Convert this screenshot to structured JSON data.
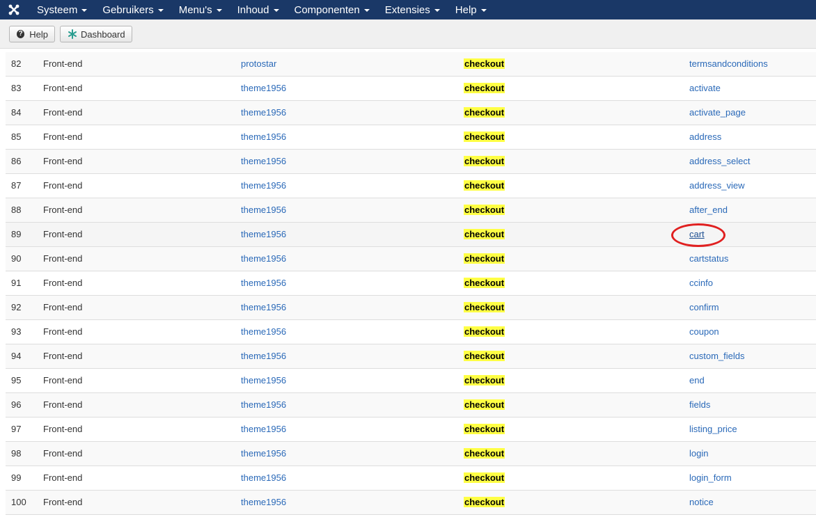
{
  "navbar": {
    "logo_icon": "joomla-logo-icon",
    "menu": [
      {
        "label": "Systeem"
      },
      {
        "label": "Gebruikers"
      },
      {
        "label": "Menu's"
      },
      {
        "label": "Inhoud"
      },
      {
        "label": "Componenten"
      },
      {
        "label": "Extensies"
      },
      {
        "label": "Help"
      }
    ]
  },
  "toolbar": {
    "help_label": "Help",
    "dashboard_label": "Dashboard",
    "help_icon": "question-circle-icon",
    "dashboard_icon": "dashboard-asterisk-icon"
  },
  "colors": {
    "navbar": "#1a3867",
    "link": "#2a69b8",
    "highlight": "#ffff44",
    "annotation": "#e02020"
  },
  "table": {
    "rows": [
      {
        "id": "82",
        "location": "Front-end",
        "template": "protostar",
        "view": "checkout",
        "file": "termsandconditions"
      },
      {
        "id": "83",
        "location": "Front-end",
        "template": "theme1956",
        "view": "checkout",
        "file": "activate"
      },
      {
        "id": "84",
        "location": "Front-end",
        "template": "theme1956",
        "view": "checkout",
        "file": "activate_page"
      },
      {
        "id": "85",
        "location": "Front-end",
        "template": "theme1956",
        "view": "checkout",
        "file": "address"
      },
      {
        "id": "86",
        "location": "Front-end",
        "template": "theme1956",
        "view": "checkout",
        "file": "address_select"
      },
      {
        "id": "87",
        "location": "Front-end",
        "template": "theme1956",
        "view": "checkout",
        "file": "address_view"
      },
      {
        "id": "88",
        "location": "Front-end",
        "template": "theme1956",
        "view": "checkout",
        "file": "after_end"
      },
      {
        "id": "89",
        "location": "Front-end",
        "template": "theme1956",
        "view": "checkout",
        "file": "cart"
      },
      {
        "id": "90",
        "location": "Front-end",
        "template": "theme1956",
        "view": "checkout",
        "file": "cartstatus"
      },
      {
        "id": "91",
        "location": "Front-end",
        "template": "theme1956",
        "view": "checkout",
        "file": "ccinfo"
      },
      {
        "id": "92",
        "location": "Front-end",
        "template": "theme1956",
        "view": "checkout",
        "file": "confirm"
      },
      {
        "id": "93",
        "location": "Front-end",
        "template": "theme1956",
        "view": "checkout",
        "file": "coupon"
      },
      {
        "id": "94",
        "location": "Front-end",
        "template": "theme1956",
        "view": "checkout",
        "file": "custom_fields"
      },
      {
        "id": "95",
        "location": "Front-end",
        "template": "theme1956",
        "view": "checkout",
        "file": "end"
      },
      {
        "id": "96",
        "location": "Front-end",
        "template": "theme1956",
        "view": "checkout",
        "file": "fields"
      },
      {
        "id": "97",
        "location": "Front-end",
        "template": "theme1956",
        "view": "checkout",
        "file": "listing_price"
      },
      {
        "id": "98",
        "location": "Front-end",
        "template": "theme1956",
        "view": "checkout",
        "file": "login"
      },
      {
        "id": "99",
        "location": "Front-end",
        "template": "theme1956",
        "view": "checkout",
        "file": "login_form"
      },
      {
        "id": "100",
        "location": "Front-end",
        "template": "theme1956",
        "view": "checkout",
        "file": "notice"
      }
    ]
  }
}
